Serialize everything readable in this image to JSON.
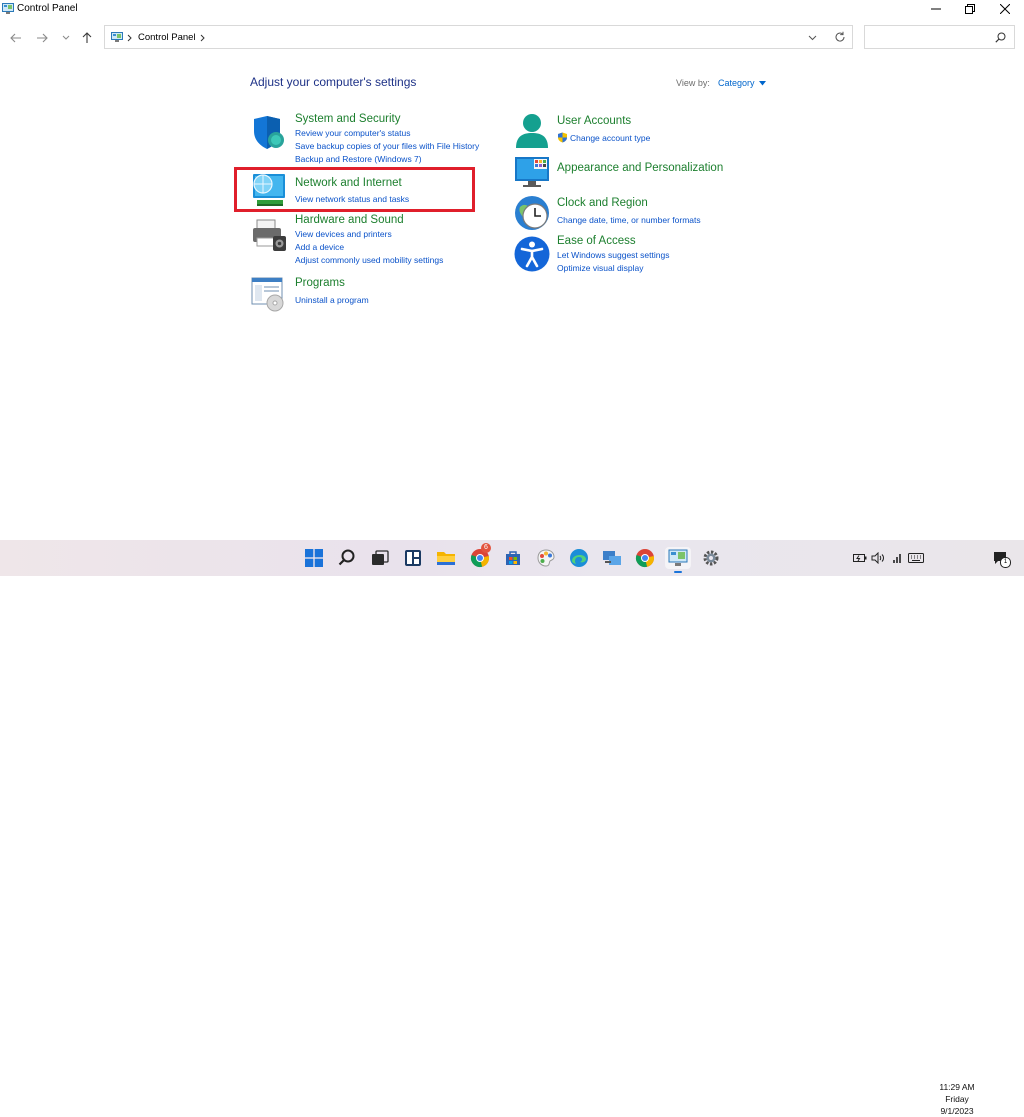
{
  "window": {
    "title": "Control Panel",
    "address": "Control Panel",
    "search_placeholder": ""
  },
  "content": {
    "heading": "Adjust your computer's settings",
    "view_by_label": "View by:",
    "view_by_value": "Category"
  },
  "categories_left": [
    {
      "title": "System and Security",
      "links": [
        "Review your computer's status",
        "Save backup copies of your files with File History",
        "Backup and Restore (Windows 7)"
      ]
    },
    {
      "title": "Network and Internet",
      "links": [
        "View network status and tasks"
      ]
    },
    {
      "title": "Hardware and Sound",
      "links": [
        "View devices and printers",
        "Add a device",
        "Adjust commonly used mobility settings"
      ]
    },
    {
      "title": "Programs",
      "links": [
        "Uninstall a program"
      ]
    }
  ],
  "categories_right": [
    {
      "title": "User Accounts",
      "links": [
        "Change account type"
      ]
    },
    {
      "title": "Appearance and Personalization",
      "links": []
    },
    {
      "title": "Clock and Region",
      "links": [
        "Change date, time, or number formats"
      ]
    },
    {
      "title": "Ease of Access",
      "links": [
        "Let Windows suggest settings",
        "Optimize visual display"
      ]
    }
  ],
  "taskbar": {
    "apps": [
      "start-icon",
      "search-icon",
      "task-view-icon",
      "widgets-icon",
      "file-explorer-icon",
      "chrome-icon",
      "store-icon",
      "paint-icon",
      "edge-icon",
      "network-app-icon",
      "chrome-icon",
      "control-panel-icon",
      "settings-icon"
    ],
    "chrome_badge": "6",
    "clock_time": "11:29 AM",
    "clock_day": "Friday",
    "clock_date": "9/1/2023",
    "notification_count": "1"
  },
  "colors": {
    "category_title": "#1c7f2e",
    "link": "#0a52c9",
    "heading": "#1e3287",
    "highlight": "#e01f2b"
  }
}
